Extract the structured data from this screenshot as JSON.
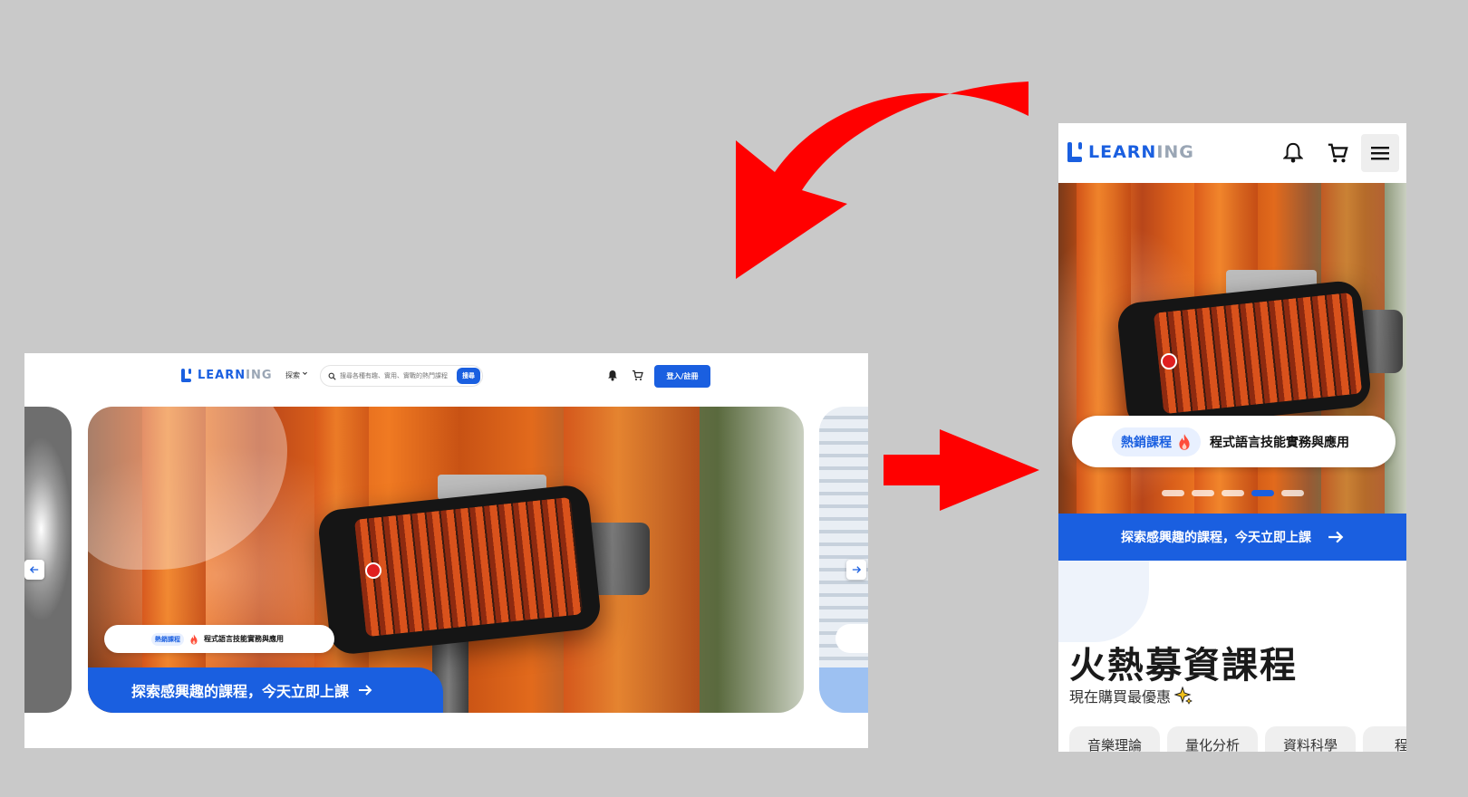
{
  "brand": {
    "logo_learn": "LEARN",
    "logo_ing": "ING",
    "primary_color": "#1a5fe0"
  },
  "desktop": {
    "nav": {
      "explore_label": "探索",
      "search_placeholder": "搜尋各種有趣、實用、實戰的熱門課程",
      "search_button": "搜尋",
      "login_button": "登入/註冊"
    },
    "hero": {
      "tag": "熱銷課程",
      "course_title": "程式語言技能實務與應用",
      "cta": "探索感興趣的課程，今天立即上課"
    }
  },
  "mobile": {
    "hero": {
      "tag": "熱銷課程",
      "course_title": "程式語言技能實務與應用",
      "cta": "探索感興趣的課程，今天立即上課",
      "active_slide": 4,
      "slide_count": 5
    },
    "section_title": "火熱募資課程",
    "section_subtitle": "現在購買最優惠",
    "chips": [
      "音樂理論",
      "量化分析",
      "資料科學",
      "程式"
    ]
  },
  "icons": {
    "bell": "bell-icon",
    "cart": "cart-icon",
    "menu": "hamburger-menu-icon",
    "search": "search-icon",
    "fire": "fire-icon",
    "sparkle": "sparkle-icon",
    "arrow_right": "arrow-right-icon",
    "arrow_left": "arrow-left-icon"
  },
  "annotation_color": "#ff0000"
}
